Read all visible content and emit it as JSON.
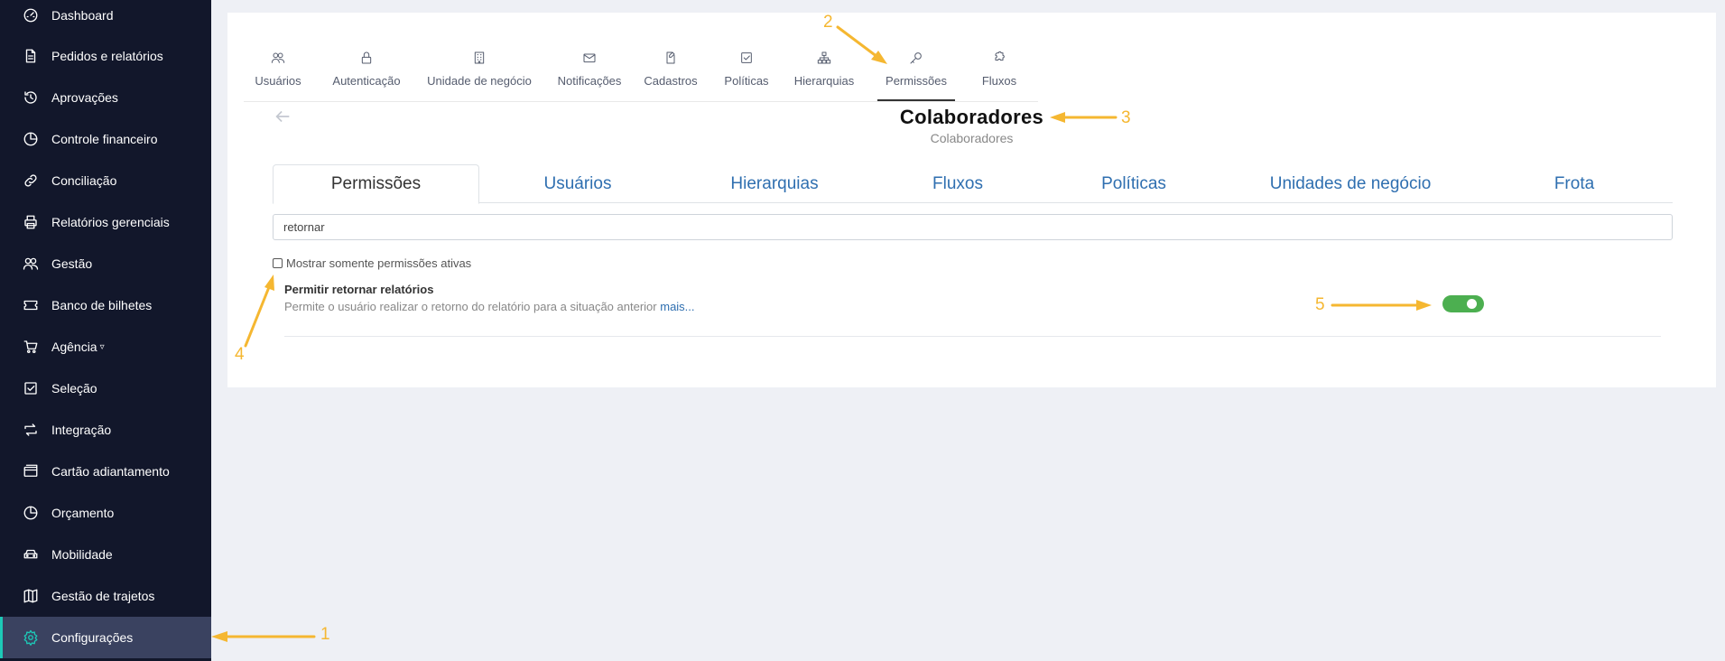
{
  "sidebar": {
    "items": [
      {
        "label": "Dashboard",
        "icon": "dashboard-icon"
      },
      {
        "label": "Pedidos e relatórios",
        "icon": "document-icon"
      },
      {
        "label": "Aprovações",
        "icon": "history-icon"
      },
      {
        "label": "Controle financeiro",
        "icon": "pie-chart-icon"
      },
      {
        "label": "Conciliação",
        "icon": "link-icon"
      },
      {
        "label": "Relatórios gerenciais",
        "icon": "printer-icon"
      },
      {
        "label": "Gestão",
        "icon": "users-icon"
      },
      {
        "label": "Banco de bilhetes",
        "icon": "ticket-icon"
      },
      {
        "label": "Agência",
        "icon": "cart-icon"
      },
      {
        "label": "Seleção",
        "icon": "check-square-icon"
      },
      {
        "label": "Integração",
        "icon": "repeat-icon"
      },
      {
        "label": "Cartão adiantamento",
        "icon": "card-icon"
      },
      {
        "label": "Orçamento",
        "icon": "pie-chart-icon"
      },
      {
        "label": "Mobilidade",
        "icon": "car-icon"
      },
      {
        "label": "Gestão de trajetos",
        "icon": "map-icon"
      },
      {
        "label": "Configurações",
        "icon": "gear-icon",
        "active": true
      }
    ]
  },
  "top_tabs": [
    {
      "label": "Usuários",
      "icon": "users-icon"
    },
    {
      "label": "Autenticação",
      "icon": "lock-icon"
    },
    {
      "label": "Unidade de negócio",
      "icon": "building-icon"
    },
    {
      "label": "Notificações",
      "icon": "mail-icon"
    },
    {
      "label": "Cadastros",
      "icon": "file-edit-icon"
    },
    {
      "label": "Políticas",
      "icon": "check-square-icon"
    },
    {
      "label": "Hierarquias",
      "icon": "hierarchy-icon"
    },
    {
      "label": "Permissões",
      "icon": "key-icon",
      "active": true
    },
    {
      "label": "Fluxos",
      "icon": "puzzle-icon"
    }
  ],
  "page": {
    "title": "Colaboradores",
    "subtitle": "Colaboradores"
  },
  "sub_tabs": [
    {
      "label": "Permissões",
      "active": true
    },
    {
      "label": "Usuários"
    },
    {
      "label": "Hierarquias"
    },
    {
      "label": "Fluxos"
    },
    {
      "label": "Políticas"
    },
    {
      "label": "Unidades de negócio"
    },
    {
      "label": "Frota"
    }
  ],
  "search": {
    "value": "retornar"
  },
  "filter": {
    "label": "Mostrar somente permissões ativas",
    "checked": false
  },
  "permission": {
    "title": "Permitir retornar relatórios",
    "description": "Permite o usuário realizar o retorno do relatório para a situação anterior",
    "more": "mais...",
    "enabled": true
  },
  "annotations": {
    "n1": "1",
    "n2": "2",
    "n3": "3",
    "n4": "4",
    "n5": "5"
  },
  "colors": {
    "sidebar_bg": "#12172b",
    "active_accent": "#1dc9b7",
    "link": "#2f6fb0",
    "toggle_on": "#4caf50",
    "annotation": "#f5b731"
  }
}
